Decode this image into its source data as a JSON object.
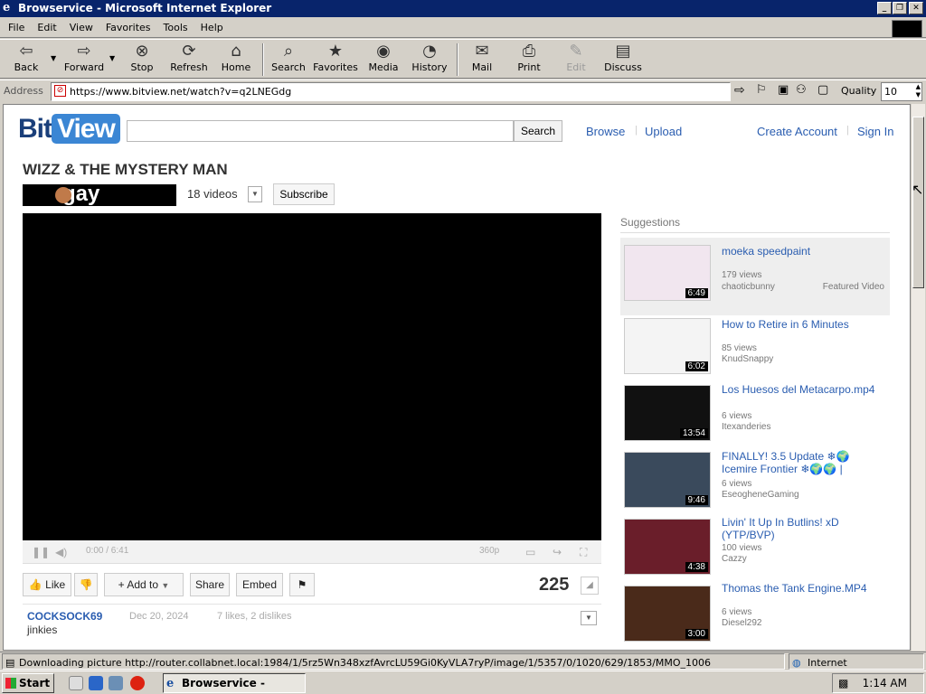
{
  "window": {
    "title": "Browservice - Microsoft Internet Explorer",
    "controls": [
      "_",
      "❐",
      "✕"
    ]
  },
  "menu": [
    "File",
    "Edit",
    "View",
    "Favorites",
    "Tools",
    "Help"
  ],
  "toolbar": {
    "back": "Back",
    "forward": "Forward",
    "stop": "Stop",
    "refresh": "Refresh",
    "home": "Home",
    "search": "Search",
    "favorites": "Favorites",
    "media": "Media",
    "history": "History",
    "mail": "Mail",
    "print": "Print",
    "edit": "Edit",
    "discuss": "Discuss"
  },
  "address": {
    "label": "Address",
    "url": "https://www.bitview.net/watch?v=q2LNEGdg",
    "quality_label": "Quality",
    "quality_value": "10"
  },
  "site": {
    "logo_left": "Bit",
    "logo_right": "View",
    "search_button": "Search",
    "nav": {
      "browse": "Browse",
      "upload": "Upload",
      "create_account": "Create Account",
      "sign_in": "Sign In"
    }
  },
  "video": {
    "title": "WIZZ & THE MYSTERY MAN",
    "channel_banner": "gay",
    "video_count": "18 videos",
    "subscribe": "Subscribe",
    "time": "0:00 / 6:41",
    "quality": "360p",
    "actions": {
      "like": "Like",
      "add_to": "Add to",
      "share": "Share",
      "embed": "Embed"
    },
    "views": "225",
    "uploader": "COCKSOCK69",
    "date": "Dec 20, 2024",
    "stats": "7 likes, 2 dislikes",
    "description": "jinkies"
  },
  "suggestions": {
    "heading": "Suggestions",
    "items": [
      {
        "title": "moeka speedpaint",
        "views": "179 views",
        "author": "chaoticbunny",
        "featured": "Featured Video",
        "duration": "6:49"
      },
      {
        "title": "How to Retire in 6 Minutes",
        "views": "85 views",
        "author": "KnudSnappy",
        "featured": "",
        "duration": "6:02"
      },
      {
        "title": "Los Huesos del Metacarpo.mp4",
        "views": "6 views",
        "author": "Itexanderies",
        "featured": "",
        "duration": "13:54"
      },
      {
        "title": "FINALLY! 3.5 Update ❄🌍 Icemire Frontier ❄🌍🌍 |",
        "views": "6 views",
        "author": "EseogheneGaming",
        "featured": "",
        "duration": "9:46"
      },
      {
        "title": "Livin' It Up In Butlins! xD (YTP/BVP)",
        "views": "100 views",
        "author": "Cazzy",
        "featured": "",
        "duration": "4:38"
      },
      {
        "title": "Thomas the Tank Engine.MP4",
        "views": "6 views",
        "author": "Diesel292",
        "featured": "",
        "duration": "3:00"
      }
    ]
  },
  "status": {
    "message": "Downloading picture http://router.collabnet.local:1984/1/5rz5Wn348xzfAvrcLU59Gi0KyVLA7ryP/image/1/5357/0/1020/629/1853/MMO_1006",
    "zone": "Internet"
  },
  "taskbar": {
    "start": "Start",
    "task": "Browservice - Micro...",
    "clock": "1:14 AM"
  }
}
